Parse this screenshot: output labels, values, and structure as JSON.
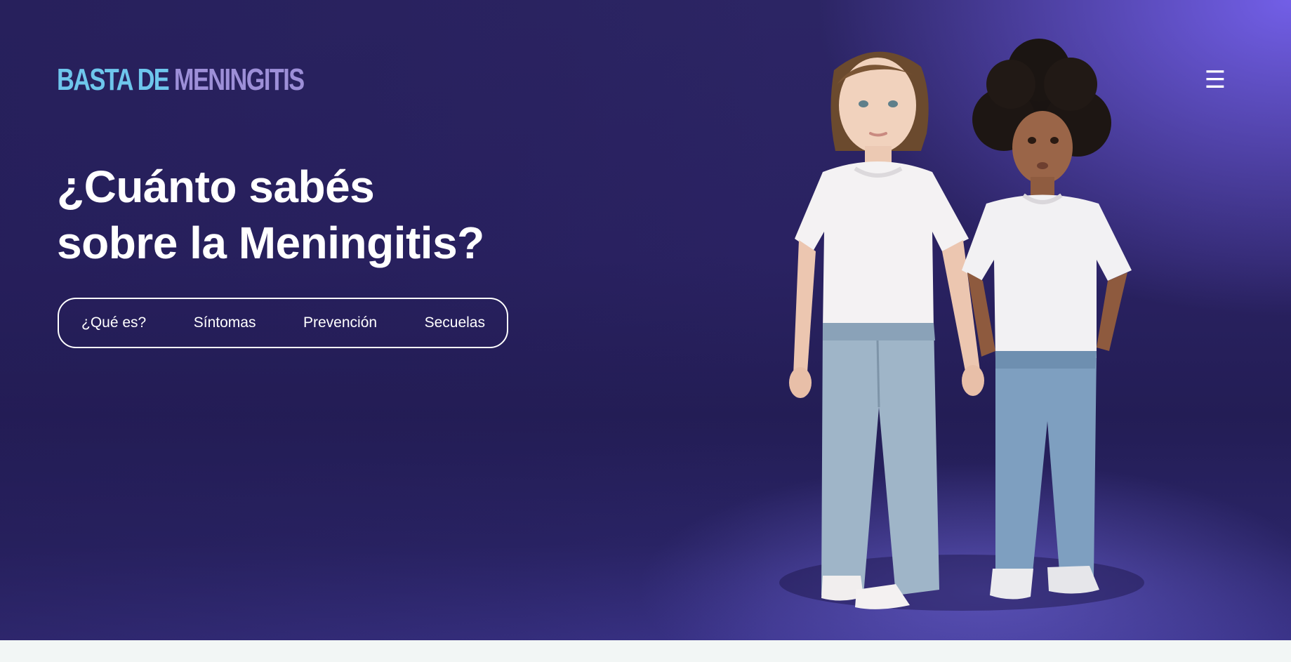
{
  "header": {
    "logo_part1": "BASTA DE",
    "logo_part2": "MENINGITIS",
    "menu_icon": "hamburger-icon",
    "menu_glyph": "☰"
  },
  "hero": {
    "headline_line1": "¿Cuánto sabés",
    "headline_line2": "sobre la Meningitis?",
    "image_subject": "two-children-standing"
  },
  "nav": {
    "items": [
      {
        "label": "¿Qué es?"
      },
      {
        "label": "Síntomas"
      },
      {
        "label": "Prevención"
      },
      {
        "label": "Secuelas"
      }
    ]
  },
  "colors": {
    "hero_dark": "#231d55",
    "hero_accent": "#7662ee",
    "logo_blue": "#6ec6ec",
    "logo_purple": "#9d8fd8",
    "text": "#ffffff",
    "page_bg": "#f2f6f5"
  }
}
